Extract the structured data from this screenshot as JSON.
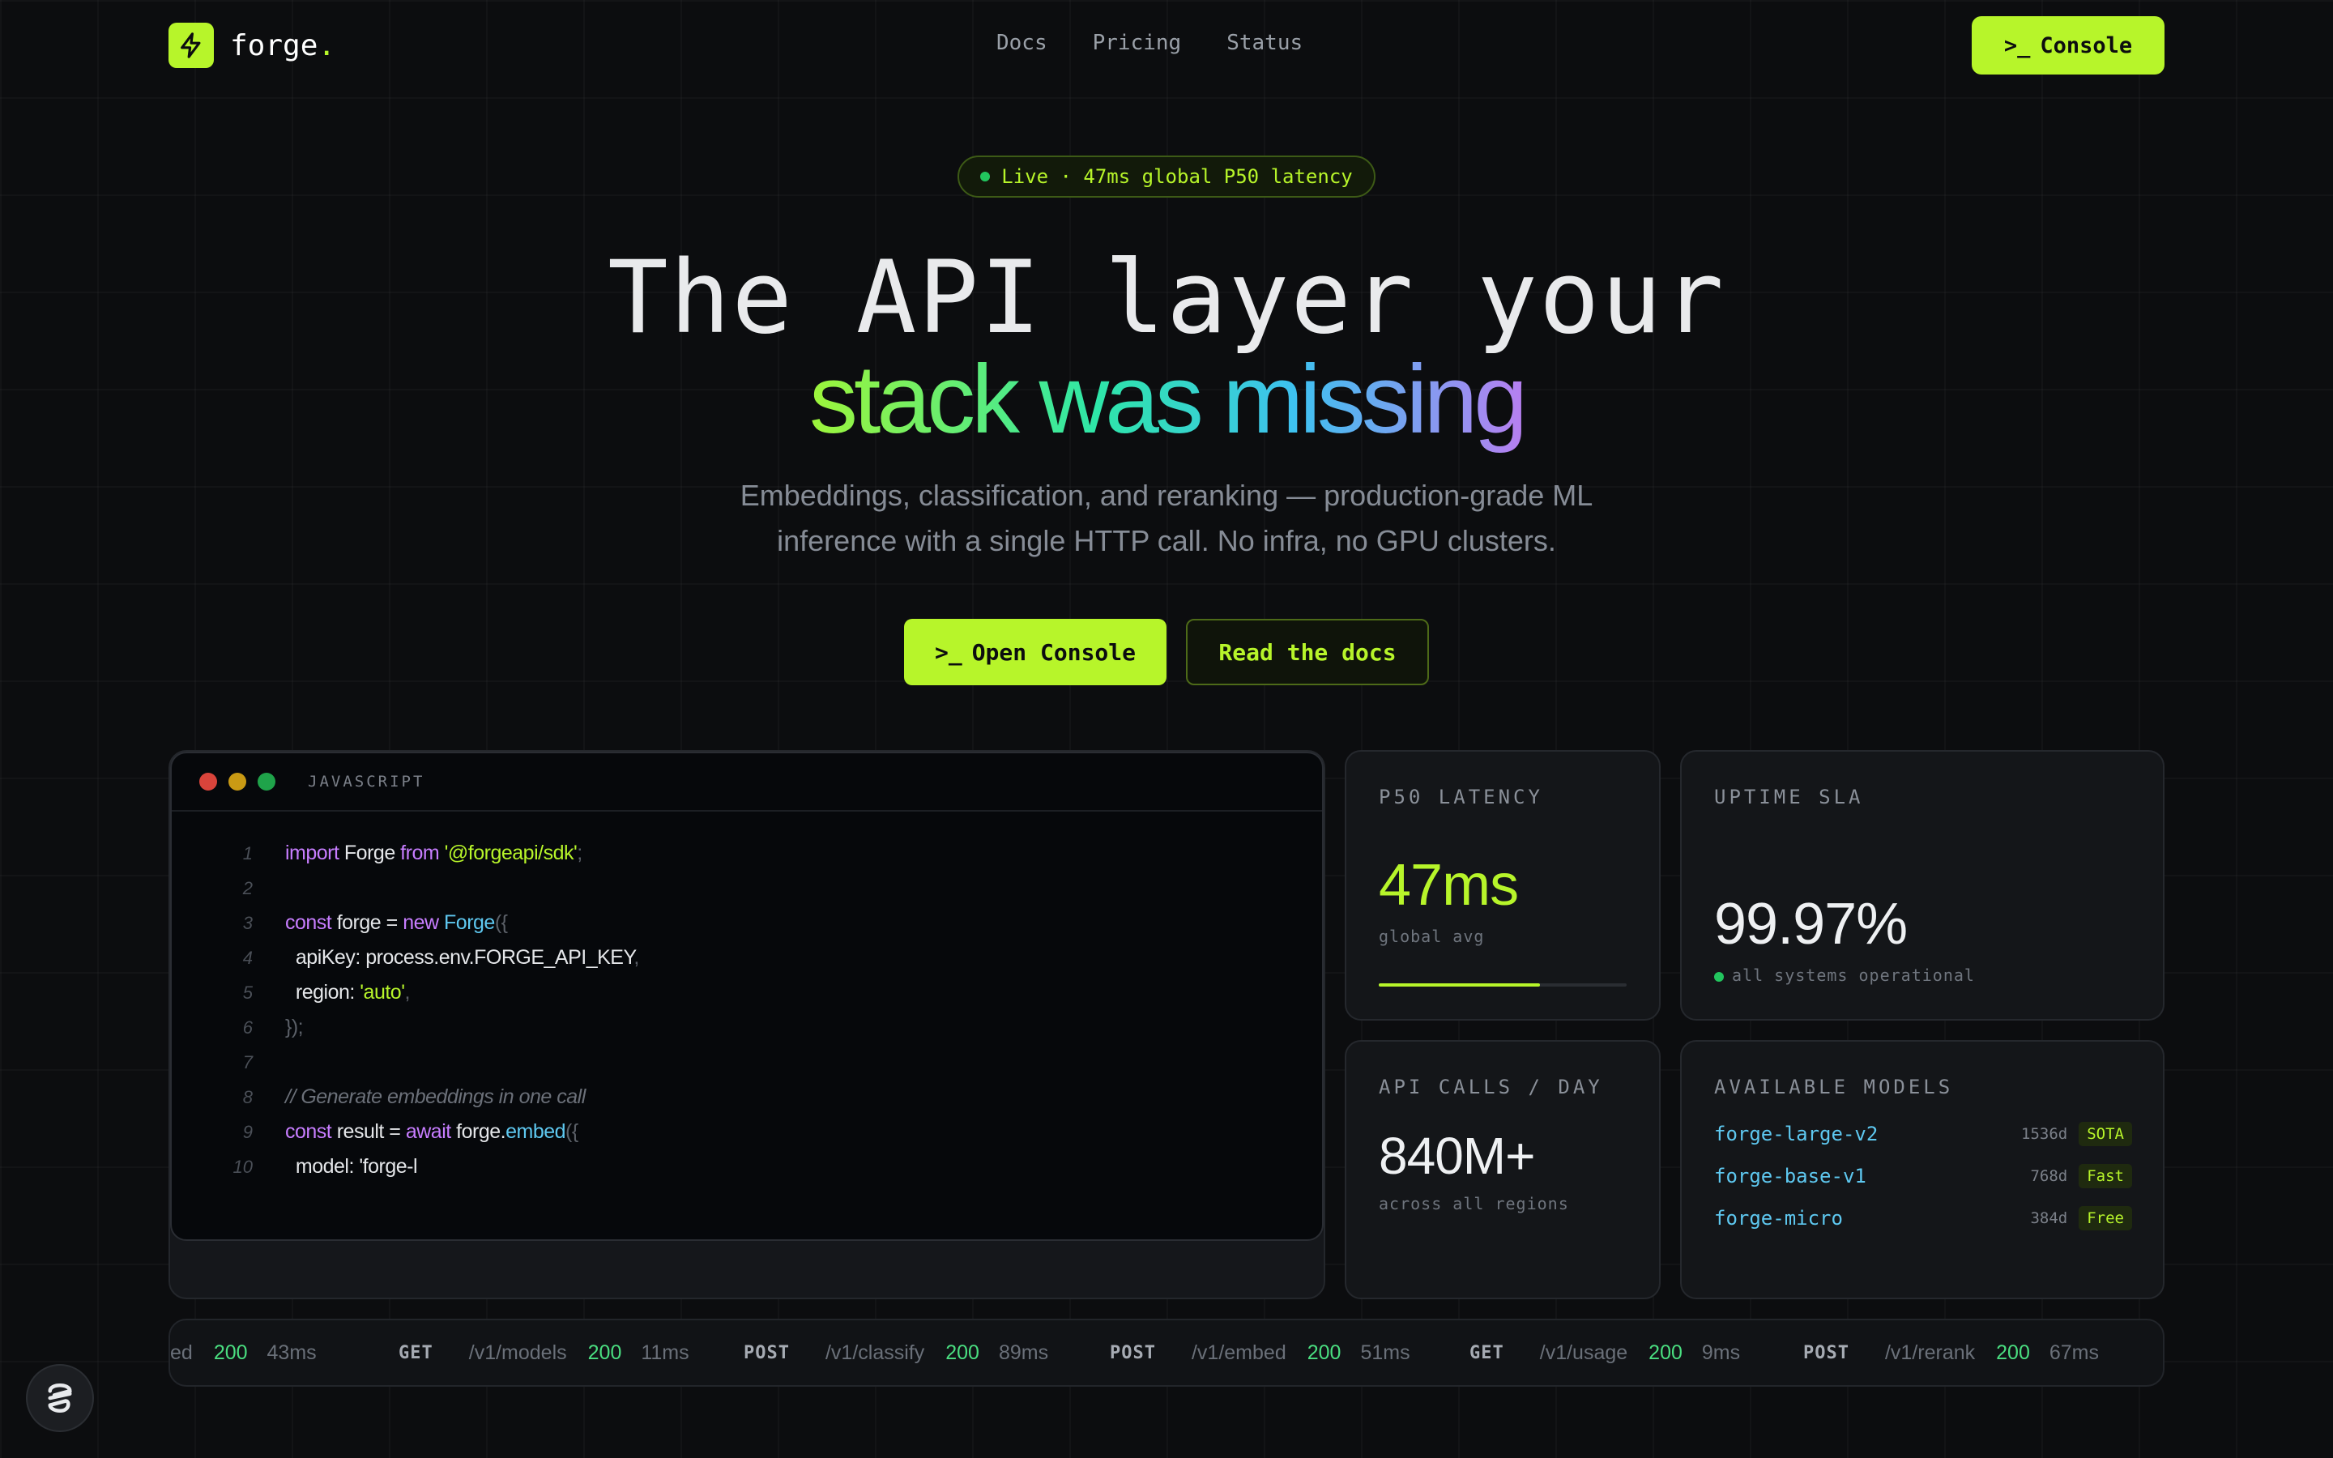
{
  "nav": {
    "logo_text": "forge",
    "logo_dot": ".",
    "links": [
      "Docs",
      "Pricing",
      "Status"
    ],
    "console_label": "Console",
    "prompt_glyph": ">_"
  },
  "hero": {
    "pill": "Live · 47ms global P50 latency",
    "title_line1": "The API layer your",
    "title_line2": "stack was missing",
    "subtitle_line1": "Embeddings, classification, and reranking — production-grade ML",
    "subtitle_line2": "inference with a single HTTP call. No infra, no GPU clusters.",
    "primary_cta": "Open Console",
    "secondary_cta": "Read the docs"
  },
  "code": {
    "language": "JAVASCRIPT",
    "line_numbers": [
      "1",
      "2",
      "3",
      "4",
      "5",
      "6",
      "7",
      "8",
      "9",
      "10"
    ]
  },
  "stats": {
    "latency": {
      "label": "P50 LATENCY",
      "value": "47ms",
      "caption": "global avg",
      "progress": 0.65
    },
    "uptime": {
      "label": "UPTIME SLA",
      "value": "99.97%",
      "caption": "all systems operational"
    },
    "calls": {
      "label": "API CALLS / DAY",
      "value": "840M+",
      "caption": "across all regions"
    },
    "models": {
      "label": "AVAILABLE MODELS",
      "items": [
        {
          "name": "forge-large-v2",
          "dim": "1536d",
          "badge": "SOTA"
        },
        {
          "name": "forge-base-v1",
          "dim": "768d",
          "badge": "Fast"
        },
        {
          "name": "forge-micro",
          "dim": "384d",
          "badge": "Free"
        }
      ]
    }
  },
  "ticker": [
    {
      "method": "",
      "path": "ed",
      "code": "200",
      "ms": "43ms"
    },
    {
      "method": "GET",
      "path": "/v1/models",
      "code": "200",
      "ms": "11ms"
    },
    {
      "method": "POST",
      "path": "/v1/classify",
      "code": "200",
      "ms": "89ms"
    },
    {
      "method": "POST",
      "path": "/v1/embed",
      "code": "200",
      "ms": "51ms"
    },
    {
      "method": "GET",
      "path": "/v1/usage",
      "code": "200",
      "ms": "9ms"
    },
    {
      "method": "POST",
      "path": "/v1/rerank",
      "code": "200",
      "ms": "67ms"
    }
  ],
  "colors": {
    "accent": "#b7f52a",
    "background": "#0c0d0f",
    "success": "#22c55e"
  },
  "icons": {
    "logo": "bolt-icon",
    "help": "chat-help-icon"
  }
}
